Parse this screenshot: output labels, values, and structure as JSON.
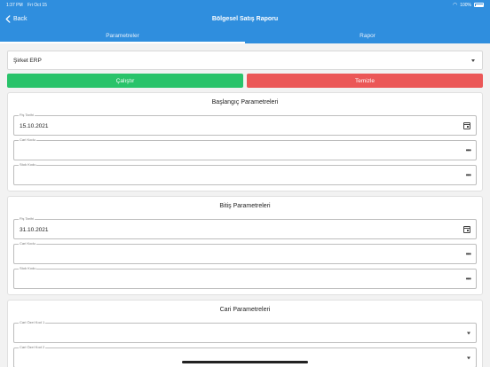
{
  "status_bar": {
    "time": "1:37 PM",
    "date": "Fri Oct 15",
    "battery": "100%",
    "icons": [
      "wifi-icon",
      "battery-icon"
    ]
  },
  "nav": {
    "back_label": "Back",
    "title": "Bölgesel Satış Raporu"
  },
  "tabs": [
    {
      "label": "Parametreler",
      "active": true
    },
    {
      "label": "Rapor",
      "active": false
    }
  ],
  "company_select": {
    "value": "Şirket ERP"
  },
  "actions": {
    "run_label": "Çalıştır",
    "clear_label": "Temizle"
  },
  "sections": [
    {
      "title": "Başlangıç Parametreleri",
      "fields": [
        {
          "label": "Fiş Tarihi",
          "value": "15.10.2021",
          "icon": "calendar-icon"
        },
        {
          "label": "Cari Kodu",
          "value": "",
          "icon": "more-icon"
        },
        {
          "label": "Stok Kodu",
          "value": "",
          "icon": "more-icon"
        }
      ]
    },
    {
      "title": "Bitiş Parametreleri",
      "fields": [
        {
          "label": "Fiş Tarihi",
          "value": "31.10.2021",
          "icon": "calendar-icon"
        },
        {
          "label": "Cari Kodu",
          "value": "",
          "icon": "more-icon"
        },
        {
          "label": "Stok Kodu",
          "value": "",
          "icon": "more-icon"
        }
      ]
    },
    {
      "title": "Cari Parametreleri",
      "fields": [
        {
          "label": "Cari Özel Kod 1",
          "value": "",
          "icon": "chevron-down-icon"
        },
        {
          "label": "Cari Özel Kod 2",
          "value": "",
          "icon": "chevron-down-icon"
        }
      ]
    }
  ],
  "colors": {
    "primary": "#2f8ede",
    "run_button": "#29c36a",
    "clear_button": "#eb5757"
  }
}
